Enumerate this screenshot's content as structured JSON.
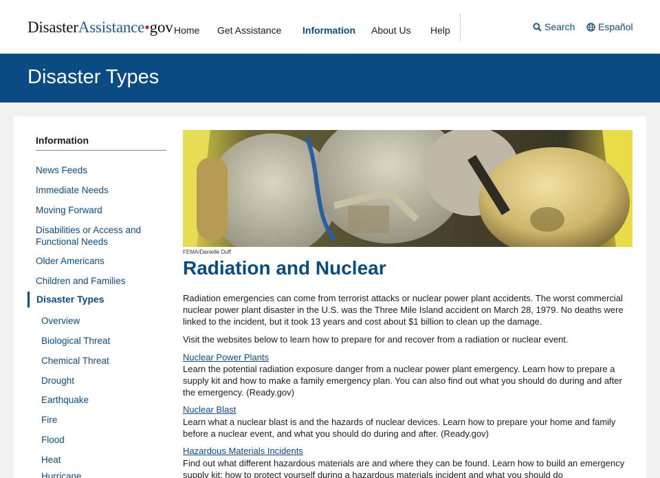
{
  "header": {
    "logo": {
      "part1": "Disaster",
      "part2": "Assistance",
      "dot": "•",
      "part3": "gov"
    },
    "nav": [
      {
        "label": "Home"
      },
      {
        "label": "Get Assistance"
      },
      {
        "label": "Information",
        "active": true
      },
      {
        "label": "About Us"
      },
      {
        "label": "Help"
      }
    ],
    "search_label": "Search",
    "search_icon": "search-icon",
    "language_label": "Español",
    "language_icon": "globe-icon"
  },
  "banner": {
    "title": "Disaster Types"
  },
  "sidebar": {
    "heading": "Information",
    "links": [
      {
        "label": "News Feeds"
      },
      {
        "label": "Immediate Needs"
      },
      {
        "label": "Moving Forward"
      },
      {
        "label": "Disabilities or Access and Functional Needs"
      },
      {
        "label": "Older Americans"
      },
      {
        "label": "Children and Families"
      }
    ],
    "active": {
      "label": "Disaster Types"
    },
    "sublinks": [
      {
        "label": "Overview"
      },
      {
        "label": "Biological Threat"
      },
      {
        "label": "Chemical Threat"
      },
      {
        "label": "Drought"
      },
      {
        "label": "Earthquake"
      },
      {
        "label": "Fire"
      },
      {
        "label": "Flood"
      },
      {
        "label": "Heat"
      },
      {
        "label": "Hurricane"
      }
    ]
  },
  "main": {
    "photo_credit": "FEMA/Danielle Duff",
    "title": "Radiation and Nuclear",
    "intro": "Radiation emergencies can come from terrorist attacks or nuclear power plant accidents. The worst commercial nuclear power plant disaster in the U.S. was the Three Mile Island accident on March 28, 1979. No deaths were linked to the incident, but it took 13 years and cost about $1 billion to clean up the damage.",
    "visit": "Visit the websites below to learn how to prepare for and recover from a radiation or nuclear event.",
    "resources": [
      {
        "link": "Nuclear Power Plants",
        "text": " Learn the potential radiation exposure danger from a nuclear power plant emergency. Learn how to prepare a supply kit and how to make a family emergency plan. You can also find out what you should do during and after the emergency. (Ready.gov)"
      },
      {
        "link": "Nuclear Blast",
        "text": "Learn what a nuclear blast is and the hazards of nuclear devices. Learn how to prepare your home and family before a nuclear event, and what you should do during and after. (Ready.gov)"
      },
      {
        "link": "Hazardous Materials Incidents",
        "text": "Find out what different hazardous materials are and where they can be found. Learn how to build an emergency supply kit; how to protect yourself during a hazardous materials incident and what you should do"
      }
    ]
  }
}
